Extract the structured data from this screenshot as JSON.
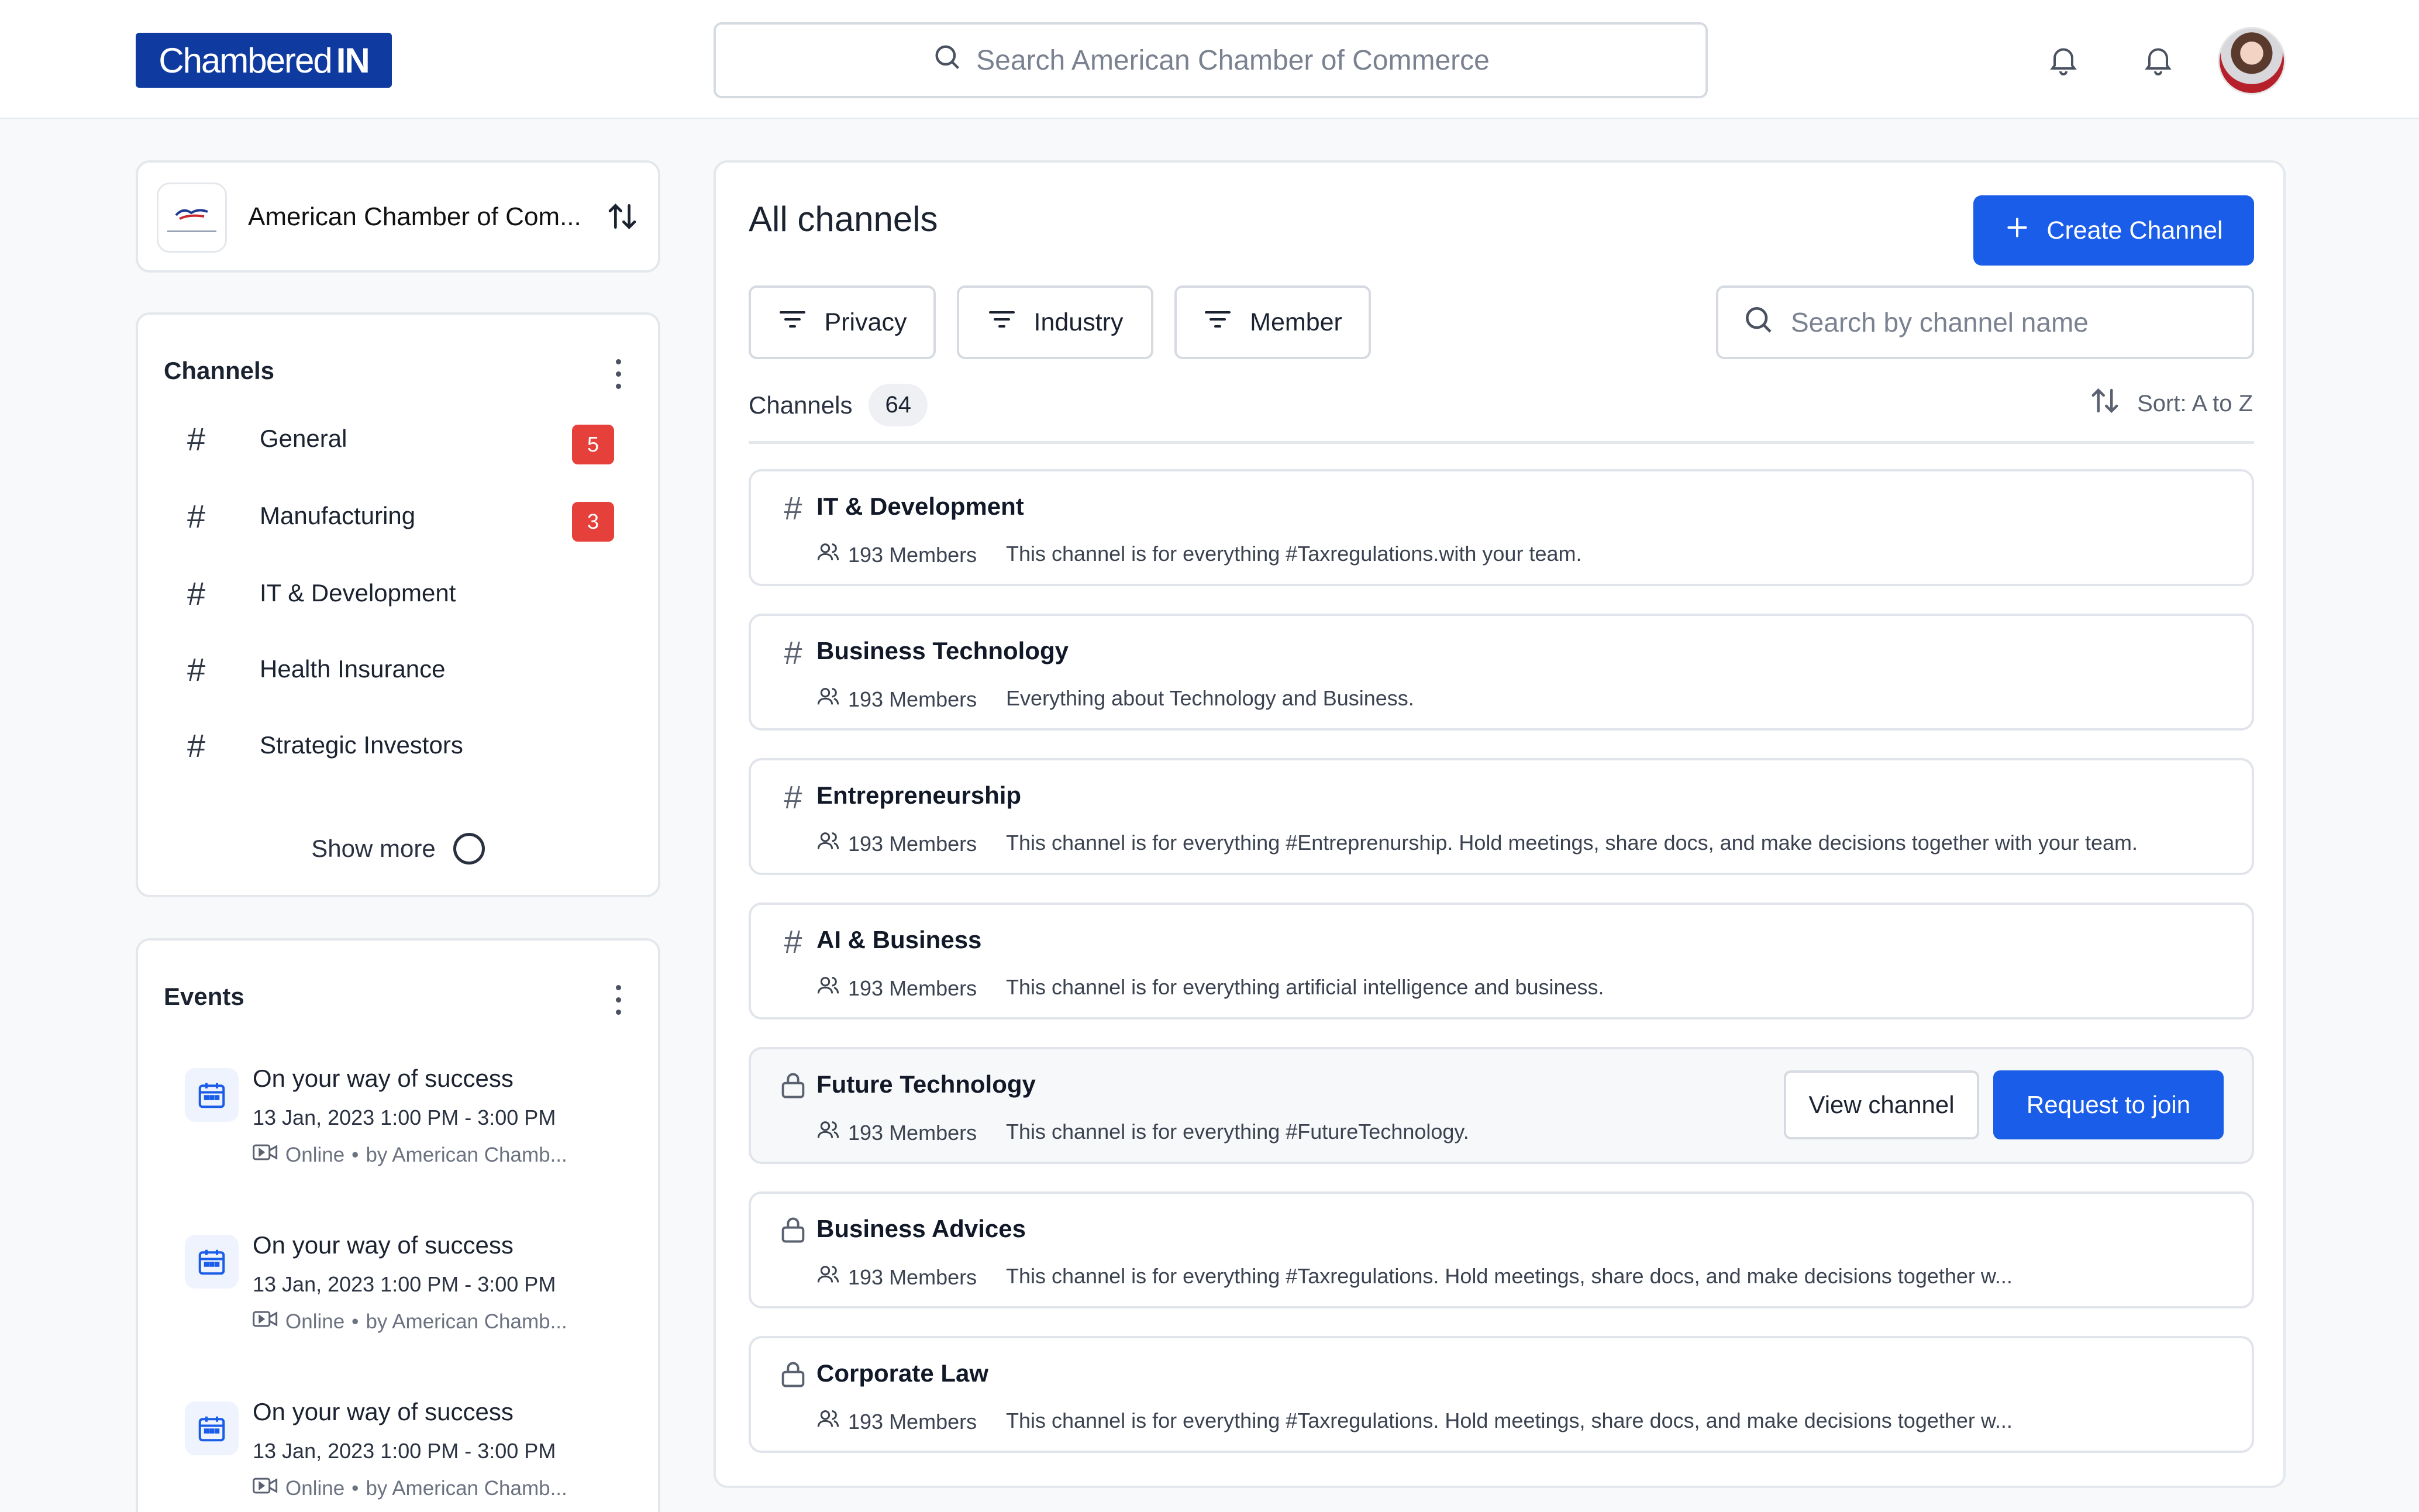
{
  "header": {
    "logo_text": "Chambered",
    "logo_bold": "IN",
    "search_placeholder": "Search American Chamber of Commerce",
    "icons": [
      "search-icon",
      "bell-icon",
      "bell-icon",
      "avatar"
    ]
  },
  "org": {
    "name": "American Chamber of Com...",
    "icon": "swap-vertical-icon"
  },
  "sidebar_channels": {
    "title": "Channels",
    "items": [
      {
        "label": "General",
        "badge": "5"
      },
      {
        "label": "Manufacturing",
        "badge": "3"
      },
      {
        "label": "IT & Development",
        "badge": ""
      },
      {
        "label": "Health Insurance",
        "badge": ""
      },
      {
        "label": "Strategic Investors",
        "badge": ""
      }
    ],
    "show_more": "Show more"
  },
  "events": {
    "title": "Events",
    "items": [
      {
        "title": "On your way of success",
        "time": "13 Jan, 2023 1:00 PM - 3:00 PM",
        "mode": "Online",
        "by": "by American Chamb..."
      },
      {
        "title": "On your way of success",
        "time": "13 Jan, 2023 1:00 PM - 3:00 PM",
        "mode": "Online",
        "by": "by American Chamb..."
      },
      {
        "title": "On your way of success",
        "time": "13 Jan, 2023 1:00 PM - 3:00 PM",
        "mode": "Online",
        "by": "by American Chamb..."
      }
    ]
  },
  "main": {
    "title": "All channels",
    "create_button": "Create Channel",
    "filters": [
      "Privacy",
      "Industry",
      "Member"
    ],
    "search_placeholder": "Search by channel name",
    "count_label": "Channels",
    "count": "64",
    "sort_label": "Sort: A to Z",
    "view_button": "View channel",
    "join_button": "Request to join",
    "channels": [
      {
        "name": "IT & Development",
        "private": false,
        "members": "193 Members",
        "desc": "This channel is for everything #Taxregulations.with your team."
      },
      {
        "name": "Business Technology",
        "private": false,
        "members": "193 Members",
        "desc": "Everything about Technology and Business."
      },
      {
        "name": "Entrepreneurship",
        "private": false,
        "members": "193 Members",
        "desc": "This channel is for everything #Entreprenurship. Hold meetings, share docs, and make decisions together with your team."
      },
      {
        "name": "AI & Business",
        "private": false,
        "members": "193 Members",
        "desc": "This channel is for everything artificial intelligence and business."
      },
      {
        "name": "Future Technology",
        "private": true,
        "members": "193 Members",
        "desc": "This channel is for everything #FutureTechnology."
      },
      {
        "name": "Business Advices",
        "private": true,
        "members": "193 Members",
        "desc": "This channel is for everything #Taxregulations. Hold meetings, share docs, and make decisions together w..."
      },
      {
        "name": "Corporate Law",
        "private": true,
        "members": "193 Members",
        "desc": "This channel is for everything #Taxregulations. Hold meetings, share docs, and make decisions together w..."
      }
    ]
  },
  "colors": {
    "brand": "#0f3aa0",
    "primary": "#1a5de8",
    "badge": "#e6403a"
  }
}
